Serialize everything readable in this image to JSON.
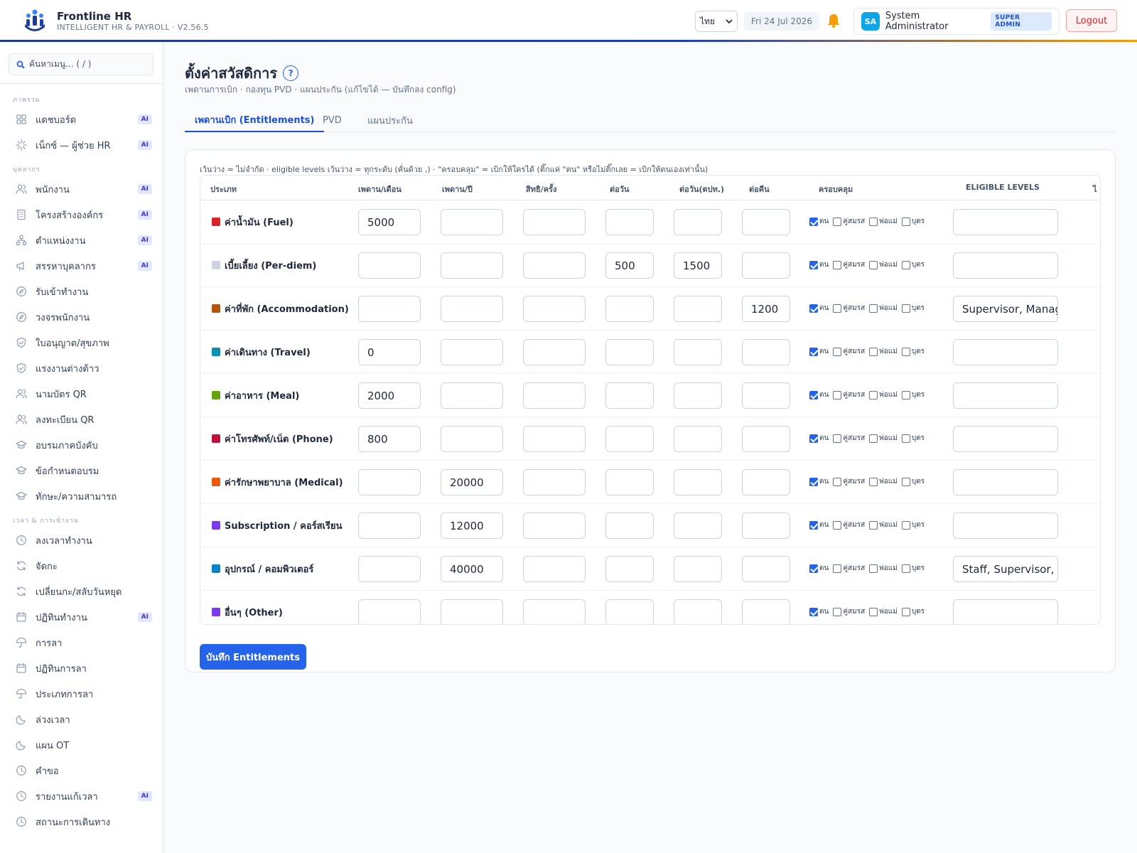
{
  "app": {
    "title": "Frontline HR",
    "subtitle": "INTELLIGENT HR & PAYROLL · V2.56.5"
  },
  "header": {
    "language": "ไทย",
    "date": "Fri 24 Jul 2026",
    "user_initials": "SA",
    "user_name": "System Administrator",
    "user_role": "SUPER ADMIN",
    "logout_label": "Logout"
  },
  "sidebar": {
    "search_placeholder": "ค้นหาเมนู... ( / )",
    "sections": [
      {
        "title": "ภาพรวม",
        "items": [
          {
            "label": "แดชบอร์ด",
            "icon": "grid-icon",
            "ai": "AI"
          },
          {
            "label": "เน็กซ์ — ผู้ช่วย HR",
            "icon": "sparkle-icon",
            "ai": "AI"
          }
        ]
      },
      {
        "title": "บุคลากร",
        "items": [
          {
            "label": "พนักงาน",
            "icon": "users-icon",
            "ai": "AI"
          },
          {
            "label": "โครงสร้างองค์กร",
            "icon": "building-icon",
            "ai": "AI"
          },
          {
            "label": "ตำแหน่งงาน",
            "icon": "hierarchy-icon",
            "ai": "AI"
          },
          {
            "label": "สรรหาบุคลากร",
            "icon": "megaphone-icon",
            "ai": "AI"
          },
          {
            "label": "รับเข้าทำงาน",
            "icon": "compass-icon",
            "ai": ""
          },
          {
            "label": "วงจรพนักงาน",
            "icon": "compass-icon",
            "ai": ""
          },
          {
            "label": "ใบอนุญาต/สุขภาพ",
            "icon": "shield-icon",
            "ai": ""
          },
          {
            "label": "แรงงานต่างด้าว",
            "icon": "shield-icon",
            "ai": ""
          },
          {
            "label": "นามบัตร QR",
            "icon": "users-icon",
            "ai": ""
          },
          {
            "label": "ลงทะเบียน QR",
            "icon": "users-icon",
            "ai": ""
          },
          {
            "label": "อบรมภาคบังคับ",
            "icon": "graduation-icon",
            "ai": ""
          },
          {
            "label": "ข้อกำหนดอบรม",
            "icon": "graduation-icon",
            "ai": ""
          },
          {
            "label": "ทักษะ/ความสามารถ",
            "icon": "graduation-icon",
            "ai": ""
          }
        ]
      },
      {
        "title": "เวลา & การเข้างาน",
        "items": [
          {
            "label": "ลงเวลาทำงาน",
            "icon": "clock-icon",
            "ai": ""
          },
          {
            "label": "จัดกะ",
            "icon": "refresh-icon",
            "ai": ""
          },
          {
            "label": "เปลี่ยนกะ/สลับวันหยุด",
            "icon": "refresh-icon",
            "ai": ""
          },
          {
            "label": "ปฏิทินทำงาน",
            "icon": "calendar-icon",
            "ai": "AI"
          },
          {
            "label": "การลา",
            "icon": "umbrella-icon",
            "ai": ""
          },
          {
            "label": "ปฏิทินการลา",
            "icon": "calendar-icon",
            "ai": ""
          },
          {
            "label": "ประเภทการลา",
            "icon": "umbrella-icon",
            "ai": ""
          },
          {
            "label": "ล่วงเวลา",
            "icon": "moon-icon",
            "ai": ""
          },
          {
            "label": "แผน OT",
            "icon": "moon-icon",
            "ai": ""
          },
          {
            "label": "คำขอ",
            "icon": "clock-icon",
            "ai": ""
          },
          {
            "label": "รายงานแก้เวลา",
            "icon": "clock-icon",
            "ai": "AI"
          },
          {
            "label": "สถานะการเดินทาง",
            "icon": "clock-icon",
            "ai": ""
          }
        ]
      }
    ]
  },
  "page": {
    "title": "ตั้งค่าสวัสดิการ",
    "help": "?",
    "subtitle": "เพดานการเบิก · กองทุน PVD · แผนประกัน (แก้ไขได้ — บันทึกลง config)",
    "tabs": [
      "เพดานเบิก (Entitlements)",
      "PVD",
      "แผนประกัน"
    ],
    "note": "เว้นว่าง = ไม่จำกัด · eligible levels เว้นว่าง = ทุกระดับ (คั่นด้วย ,) · \"ครอบคลุม\" = เบิกให้ใครได้ (ติ๊กแค่ \"ตน\" หรือไม่ติ๊กเลย = เบิกให้ตนเองเท่านั้น)",
    "save_label": "บันทึก Entitlements"
  },
  "table": {
    "headers": [
      "ประเภท",
      "เพดาน/เดือน",
      "เพดาน/ปี",
      "สิทธิ/ครั้ง",
      "ต่อวัน",
      "ต่อวัน(ตปท.)",
      "ต่อคืน",
      "ครอบคลุม",
      "ELIGIBLE LEVELS",
      "ไ"
    ],
    "coverage_labels": [
      "ตน",
      "คู่สมรส",
      "พ่อแม่",
      "บุตร"
    ],
    "rows": [
      {
        "label": "ค่าน้ำมัน (Fuel)",
        "icon": "fuel-icon",
        "color": "#dc2626",
        "monthly": "5000",
        "yearly": "",
        "per_claim": "",
        "per_day": "",
        "per_day_abroad": "",
        "per_night": "",
        "coverage": [
          true,
          false,
          false,
          false
        ],
        "levels": ""
      },
      {
        "label": "เบี้ยเลี้ยง (Per-diem)",
        "icon": "receipt-icon",
        "color": "#cbd5e1",
        "monthly": "",
        "yearly": "",
        "per_claim": "",
        "per_day": "500",
        "per_day_abroad": "1500",
        "per_night": "",
        "coverage": [
          true,
          false,
          false,
          false
        ],
        "levels": ""
      },
      {
        "label": "ค่าที่พัก (Accommodation)",
        "icon": "hotel-icon",
        "color": "#b45309",
        "monthly": "",
        "yearly": "",
        "per_claim": "",
        "per_day": "",
        "per_day_abroad": "",
        "per_night": "1200",
        "coverage": [
          true,
          false,
          false,
          false
        ],
        "levels": "Supervisor, Manager"
      },
      {
        "label": "ค่าเดินทาง (Travel)",
        "icon": "car-icon",
        "color": "#0891b2",
        "monthly": "0",
        "yearly": "",
        "per_claim": "",
        "per_day": "",
        "per_day_abroad": "",
        "per_night": "",
        "coverage": [
          true,
          false,
          false,
          false
        ],
        "levels": ""
      },
      {
        "label": "ค่าอาหาร (Meal)",
        "icon": "bento-icon",
        "color": "#65a30d",
        "monthly": "2000",
        "yearly": "",
        "per_claim": "",
        "per_day": "",
        "per_day_abroad": "",
        "per_night": "",
        "coverage": [
          true,
          false,
          false,
          false
        ],
        "levels": ""
      },
      {
        "label": "ค่าโทรศัพท์/เน็ต (Phone)",
        "icon": "phone-icon",
        "color": "#be123c",
        "monthly": "800",
        "yearly": "",
        "per_claim": "",
        "per_day": "",
        "per_day_abroad": "",
        "per_night": "",
        "coverage": [
          true,
          false,
          false,
          false
        ],
        "levels": ""
      },
      {
        "label": "ค่ารักษาพยาบาล (Medical)",
        "icon": "pill-icon",
        "color": "#ea580c",
        "monthly": "",
        "yearly": "20000",
        "per_claim": "",
        "per_day": "",
        "per_day_abroad": "",
        "per_night": "",
        "coverage": [
          true,
          false,
          false,
          false
        ],
        "levels": ""
      },
      {
        "label": "Subscription / คอร์สเรียน",
        "icon": "robot-icon",
        "color": "#7c3aed",
        "monthly": "",
        "yearly": "12000",
        "per_claim": "",
        "per_day": "",
        "per_day_abroad": "",
        "per_night": "",
        "coverage": [
          true,
          false,
          false,
          false
        ],
        "levels": ""
      },
      {
        "label": "อุปกรณ์ / คอมพิวเตอร์",
        "icon": "laptop-icon",
        "color": "#0284c7",
        "monthly": "",
        "yearly": "40000",
        "per_claim": "",
        "per_day": "",
        "per_day_abroad": "",
        "per_night": "",
        "coverage": [
          true,
          false,
          false,
          false
        ],
        "levels": "Staff, Supervisor, Manager"
      },
      {
        "label": "อื่นๆ (Other)",
        "icon": "plus-icon",
        "color": "#7c3aed",
        "monthly": "",
        "yearly": "",
        "per_claim": "",
        "per_day": "",
        "per_day_abroad": "",
        "per_night": "",
        "coverage": [
          true,
          false,
          false,
          false
        ],
        "levels": ""
      }
    ]
  }
}
